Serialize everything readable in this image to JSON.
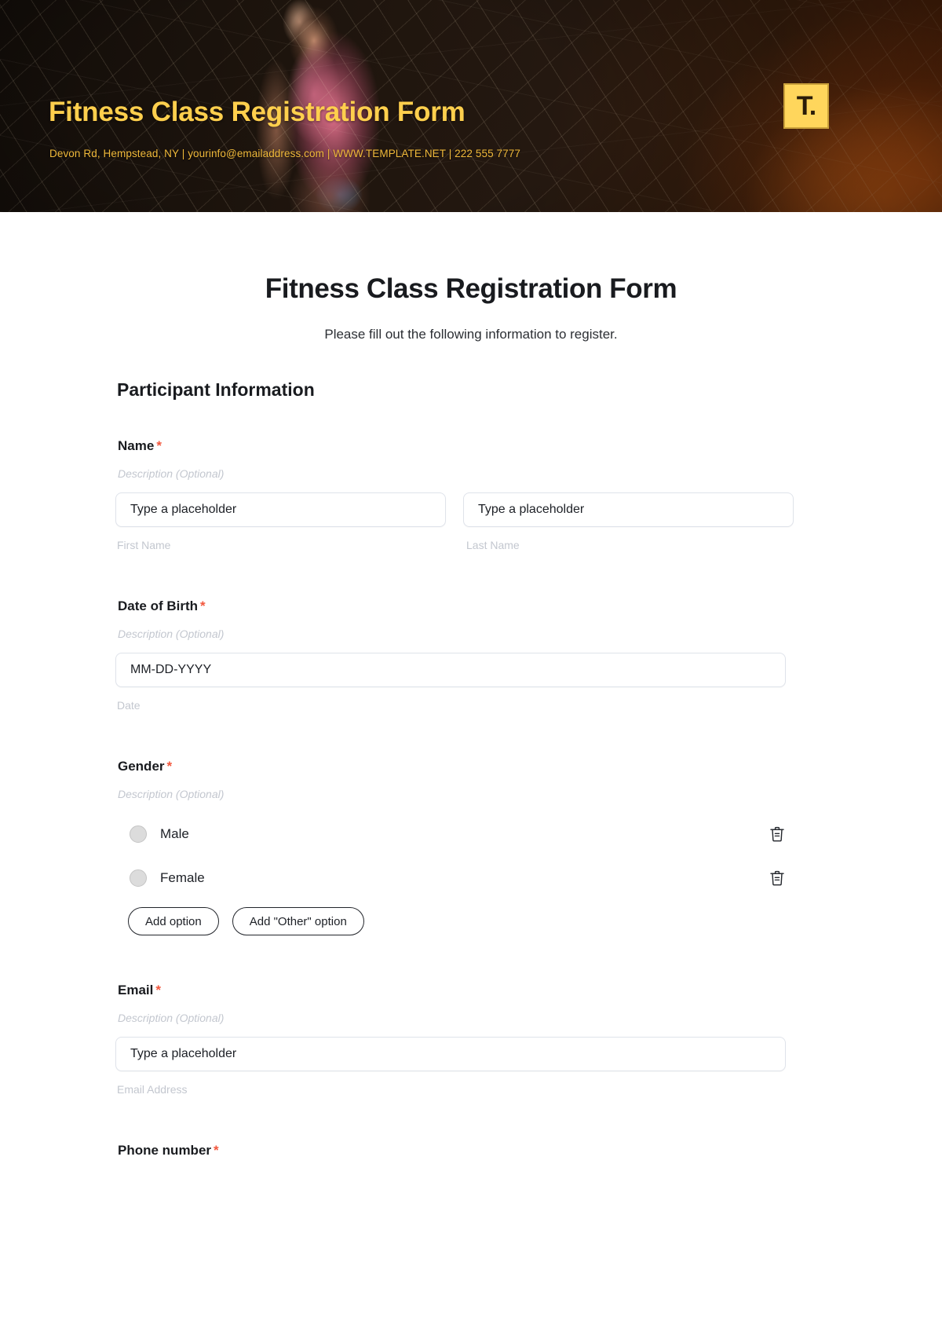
{
  "banner": {
    "title": "Fitness Class Registration Form",
    "contact": "Devon Rd, Hempstead, NY | yourinfo@emailaddress.com | WWW.TEMPLATE.NET | 222 555 7777",
    "logo_glyph": "T.",
    "logo_icon_name": "template-net-logo-icon",
    "colors": {
      "title": "#ffcf4d",
      "contact": "#f0b93a",
      "logo_background": "#ffd65c",
      "logo_border": "#c9a03a"
    }
  },
  "form": {
    "title": "Fitness Class Registration Form",
    "subtitle": "Please fill out the following information to register.",
    "section_heading": "Participant Information",
    "required_marker": "*",
    "description_placeholder": "Description (Optional)",
    "accent_required_color": "#f2573d",
    "fields": {
      "name": {
        "label": "Name",
        "description": "Description (Optional)",
        "first": {
          "value": "Type a placeholder",
          "sub_label": "First Name"
        },
        "last": {
          "value": "Type a placeholder",
          "sub_label": "Last Name"
        }
      },
      "dob": {
        "label": "Date of Birth",
        "description": "Description (Optional)",
        "value": "MM-DD-YYYY",
        "sub_label": "Date"
      },
      "gender": {
        "label": "Gender",
        "description": "Description (Optional)",
        "options": [
          "Male",
          "Female"
        ],
        "add_option_label": "Add option",
        "add_other_label": "Add \"Other\" option"
      },
      "email": {
        "label": "Email",
        "description": "Description (Optional)",
        "value": "Type a placeholder",
        "sub_label": "Email Address"
      },
      "phone": {
        "label": "Phone number"
      }
    }
  }
}
